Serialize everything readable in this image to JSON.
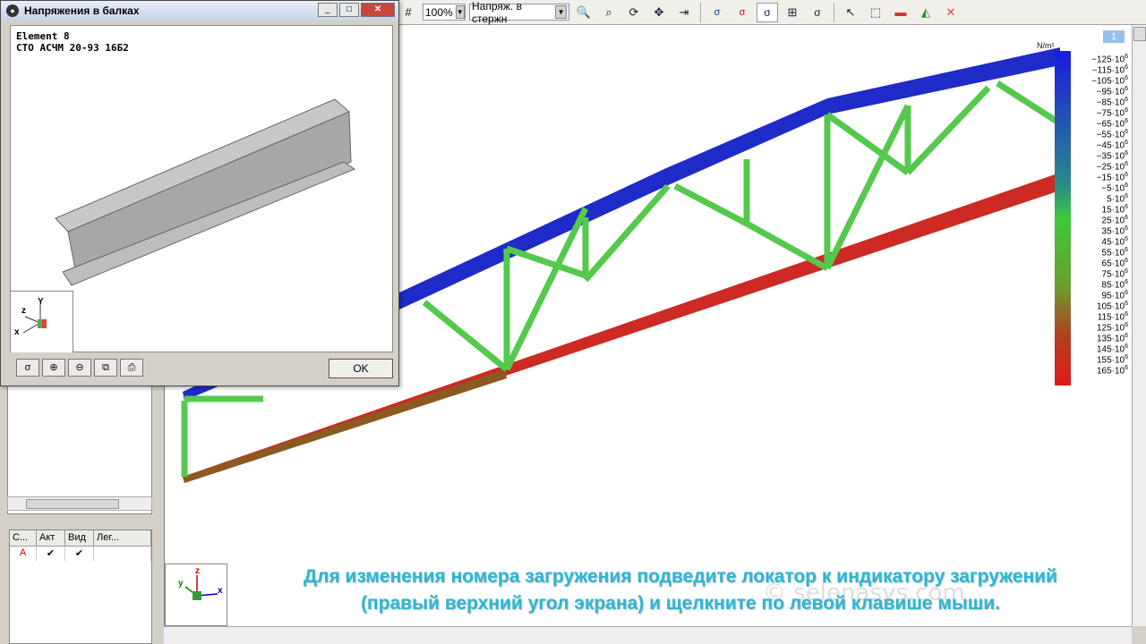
{
  "dialog": {
    "title": "Напряжения в балках",
    "element_label": "Element 8",
    "profile_label": "СТО АСЧМ 20-93 16Б2",
    "ok_label": "OK",
    "axes": {
      "x": "x",
      "y": "Y",
      "z": "z"
    }
  },
  "toolbar": {
    "zoom_value": "100%",
    "mode_value": "Напряж. в стержн"
  },
  "load_table": {
    "headers": [
      "С...",
      "Акт",
      "Вид",
      "Лег..."
    ],
    "row": [
      "A",
      "✔",
      "✔",
      ""
    ]
  },
  "viewport": {
    "load_indicator": "1",
    "axes": {
      "x": "x",
      "y": "y",
      "z": "z"
    },
    "scale_unit": "N/m²",
    "scale_labels": [
      "−125·10",
      "−115·10",
      "−105·10",
      "−95·10",
      "−85·10",
      "−75·10",
      "−65·10",
      "−55·10",
      "−45·10",
      "−35·10",
      "−25·10",
      "−15·10",
      "−5·10",
      "5·10",
      "15·10",
      "25·10",
      "35·10",
      "45·10",
      "55·10",
      "65·10",
      "75·10",
      "85·10",
      "95·10",
      "105·10",
      "115·10",
      "125·10",
      "135·10",
      "145·10",
      "155·10",
      "165·10"
    ],
    "scale_exponent": "6",
    "caption_line1": "Для изменения номера загружения подведите локатор к индикатору загружений",
    "caption_line2": "(правый верхний угол экрана) и щелкните по левой клавише мыши.",
    "watermark": "© selenasys.com"
  },
  "colors": {
    "top_chord": "#1a2fc8",
    "bottom_chord": "#d42a2a",
    "web": "#4fc64a"
  }
}
